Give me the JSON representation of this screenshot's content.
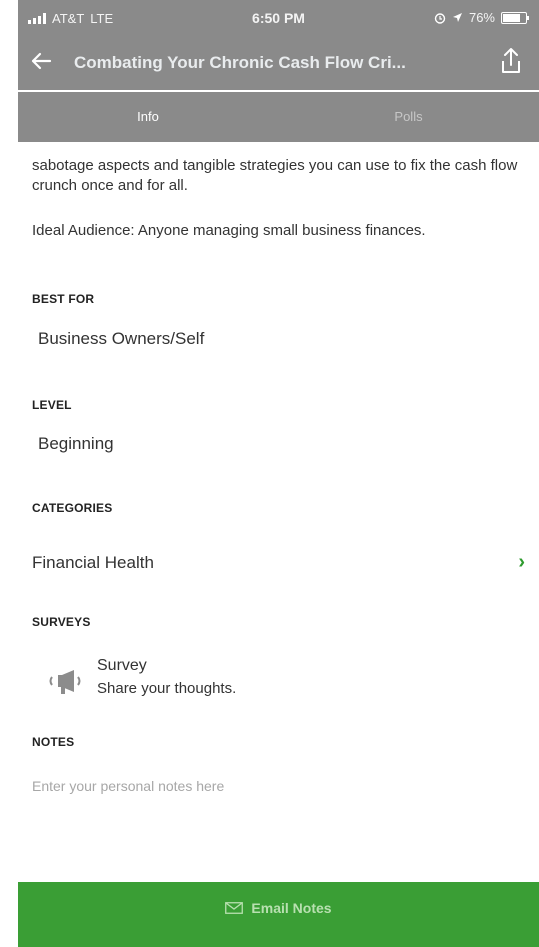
{
  "status_bar": {
    "carrier": "AT&T",
    "network": "LTE",
    "time": "6:50 PM",
    "battery": "76%",
    "icons": [
      "signal-icon",
      "alarm-icon",
      "location-icon",
      "battery-icon"
    ]
  },
  "nav": {
    "back_icon": "back-arrow-icon",
    "title": "Combating Your Chronic Cash Flow Cri...",
    "share_icon": "share-icon"
  },
  "tabs": [
    {
      "label": "Info",
      "active": true
    },
    {
      "label": "Polls",
      "active": false
    }
  ],
  "content": {
    "description": "sabotage aspects and tangible strategies you can use to fix the cash flow crunch once and for all.",
    "ideal_audience": "Ideal Audience: Anyone managing small business finances.",
    "best_for": {
      "label": "BEST FOR",
      "value": "Business Owners/Self"
    },
    "level": {
      "label": "LEVEL",
      "value": "Beginning"
    },
    "categories": {
      "label": "CATEGORIES",
      "items": [
        "Financial Health"
      ]
    },
    "surveys": {
      "label": "SURVEYS",
      "items": [
        {
          "title": "Survey",
          "subtitle": "Share your thoughts."
        }
      ]
    },
    "notes": {
      "label": "NOTES",
      "placeholder": "Enter your personal notes here"
    }
  },
  "email_button": {
    "label": "Email Notes"
  },
  "colors": {
    "header_gray": "#8a8a8a",
    "accent_green": "#3a9e35",
    "chevron_green": "#2e9b2e"
  }
}
